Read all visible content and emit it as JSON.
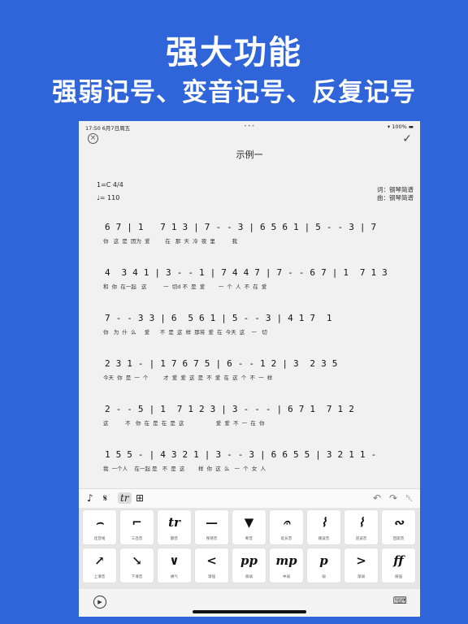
{
  "headline": {
    "line1": "强大功能",
    "line2": "强弱记号、变音记号、反复记号"
  },
  "status": {
    "time": "17:50  6月7日周五",
    "dots": "•••",
    "battery": "▾ 100% ▬"
  },
  "header": {
    "close": "×",
    "confirm": "✓",
    "title": "示例一"
  },
  "meta": {
    "key": "1=C  4/4",
    "tempo": "♩= 110",
    "lyricist": "词：钢琴简谱",
    "composer": "曲：钢琴简谱"
  },
  "score": [
    {
      "notes": "6 7 | 1   7 1 3 | 7 - - 3 | 6 5 6 1 | 5 - - 3 | 7",
      "lyrics": "你   这  是  因为  爱         在   那  天  冷  夜  里          我"
    },
    {
      "notes": "4  3 4 1 | 3 - - 1 | 7 4 4 7 | 7 - - 6 7 | 1  7 1 3",
      "lyrics": "和  你  在一起   这          一  切d 不  是  爱        一  个  人  不  在  爱"
    },
    {
      "notes": "7 - - 3 3 | 6  5 6 1 | 5 - - 3 | 4 1 7  1",
      "lyrics": "你   为  什  么     爱      不  是  这  样  那将  爱  在  今天  这    一   切"
    },
    {
      "notes": "2 3 1 - | 1 7 6 7 5 | 6 - - 1 2 | 3  2 3 5",
      "lyrics": "今天  你  是  一  个         才  爱  爱  这  是  不  爱  在  这  个  不  一  样"
    },
    {
      "notes": "2 - - 5 | 1  7 1 2 3 | 3 - - - | 6 7 1  7 1 2",
      "lyrics": "这          不   你  在  是  在  是  这                   爱  爱  不  一  在  你"
    },
    {
      "notes": "1 5 5 - | 4 3 2 1 | 3 - - 3 | 6 6 5 5 | 3 2 1 1 -",
      "lyrics": "我  一个人    在一起 是   不  是  这        样  你  这  么   一  个  女  人"
    }
  ],
  "tools": {
    "note": "♪",
    "segno": "𝄋",
    "trill": "tr",
    "grid": "⊞",
    "undo": "↶",
    "redo": "↷",
    "trash": "␡"
  },
  "palette": {
    "row1": [
      {
        "sym": "⌢",
        "label": "连音线"
      },
      {
        "sym": "⌐",
        "label": "三连音"
      },
      {
        "sym": "tr",
        "label": "颤音"
      },
      {
        "sym": "—",
        "label": "保持音"
      },
      {
        "sym": "▼",
        "label": "断音"
      },
      {
        "sym": "𝄐",
        "label": "延长音"
      },
      {
        "sym": "⌇",
        "label": "顺波音"
      },
      {
        "sym": "⌇",
        "label": "逆波音"
      },
      {
        "sym": "∾",
        "label": "回旋音"
      }
    ],
    "row2": [
      {
        "sym": "↗",
        "label": "上滑音"
      },
      {
        "sym": "↘",
        "label": "下滑音"
      },
      {
        "sym": "∨",
        "label": "换气"
      },
      {
        "sym": "<",
        "label": "渐强"
      },
      {
        "sym": "pp",
        "label": "很弱"
      },
      {
        "sym": "mp",
        "label": "中弱"
      },
      {
        "sym": "p",
        "label": "弱"
      },
      {
        "sym": ">",
        "label": "渐弱"
      },
      {
        "sym": "ff",
        "label": "很强"
      }
    ]
  },
  "bottom": {
    "play": "▶",
    "keyboard": "⌨"
  },
  "colors": {
    "background": "#2f65d9",
    "highlight": "#c9d6ff"
  }
}
